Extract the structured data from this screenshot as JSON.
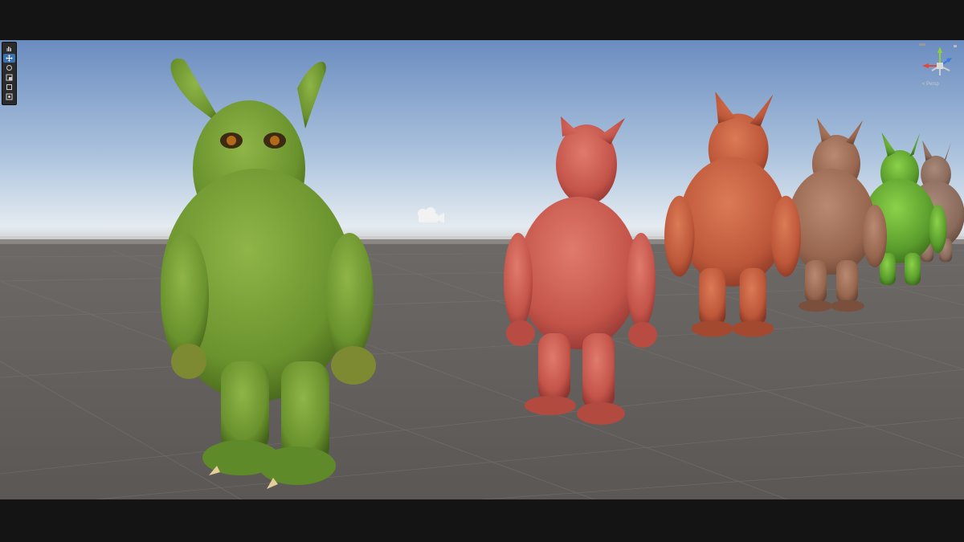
{
  "window": {
    "title": ""
  },
  "scene_toolbar": {
    "tools": [
      {
        "name": "hand-tool",
        "icon": "hand-icon",
        "active": false
      },
      {
        "name": "move-tool",
        "icon": "move-arrows-icon",
        "active": true
      },
      {
        "name": "rotate-tool",
        "icon": "rotate-icon",
        "active": false
      },
      {
        "name": "scale-tool",
        "icon": "scale-icon",
        "active": false
      },
      {
        "name": "rect-tool",
        "icon": "rect-transform-icon",
        "active": false
      },
      {
        "name": "transform-tool",
        "icon": "transform-icon",
        "active": false
      }
    ]
  },
  "orientation_gizmo": {
    "projection_label": "< Persp",
    "axis_colors": {
      "x": "#e0463c",
      "y": "#8fce3c",
      "z": "#3a7de0"
    }
  },
  "scene": {
    "objects": [
      {
        "name": "creature-green-large",
        "color": "#6e9a34"
      },
      {
        "name": "creature-red",
        "color": "#c9574a"
      },
      {
        "name": "creature-orange",
        "color": "#c35d3c"
      },
      {
        "name": "creature-brown",
        "color": "#9a6a54"
      },
      {
        "name": "creature-green-small",
        "color": "#5a9c2c"
      },
      {
        "name": "creature-brown-far",
        "color": "#8a6a5a"
      }
    ],
    "sky_color_top": "#6b8cc0",
    "horizon_color": "#dfe7ee",
    "ground_color": "#5f5b59"
  }
}
